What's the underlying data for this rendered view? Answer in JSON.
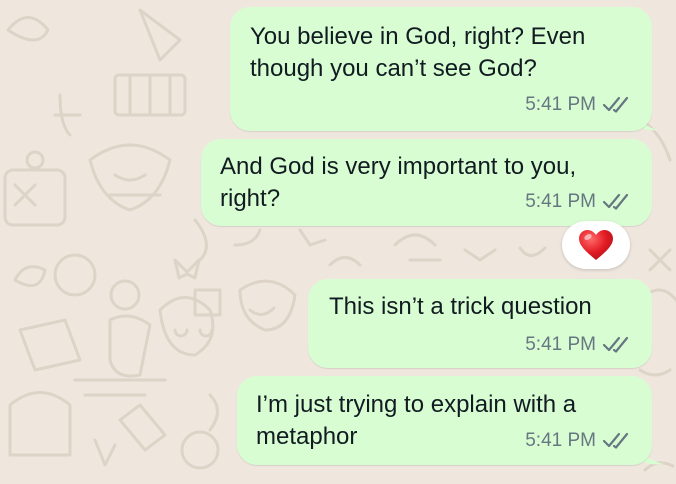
{
  "colors": {
    "wallpaper": "#efe7de",
    "outgoing_bubble": "#d9fdd3",
    "meta_text": "#667781",
    "reaction_heart": "#e21b23"
  },
  "messages": [
    {
      "lines": [
        "You believe in God, right? Even",
        "though you can’t see God?"
      ],
      "time": "5:41 PM",
      "status": "double-check-icon"
    },
    {
      "lines": [
        "And God is very important to you,",
        "right?"
      ],
      "time": "5:41 PM",
      "status": "double-check-icon"
    },
    {
      "lines": [
        "This isn’t a trick question"
      ],
      "time": "5:41 PM",
      "status": "double-check-icon"
    },
    {
      "lines": [
        "I’m just trying to explain with a",
        "metaphor"
      ],
      "time": "5:41 PM",
      "status": "double-check-icon"
    }
  ],
  "reaction": {
    "emoji": "❤️",
    "icon": "red-heart-icon",
    "on_message": 2
  }
}
